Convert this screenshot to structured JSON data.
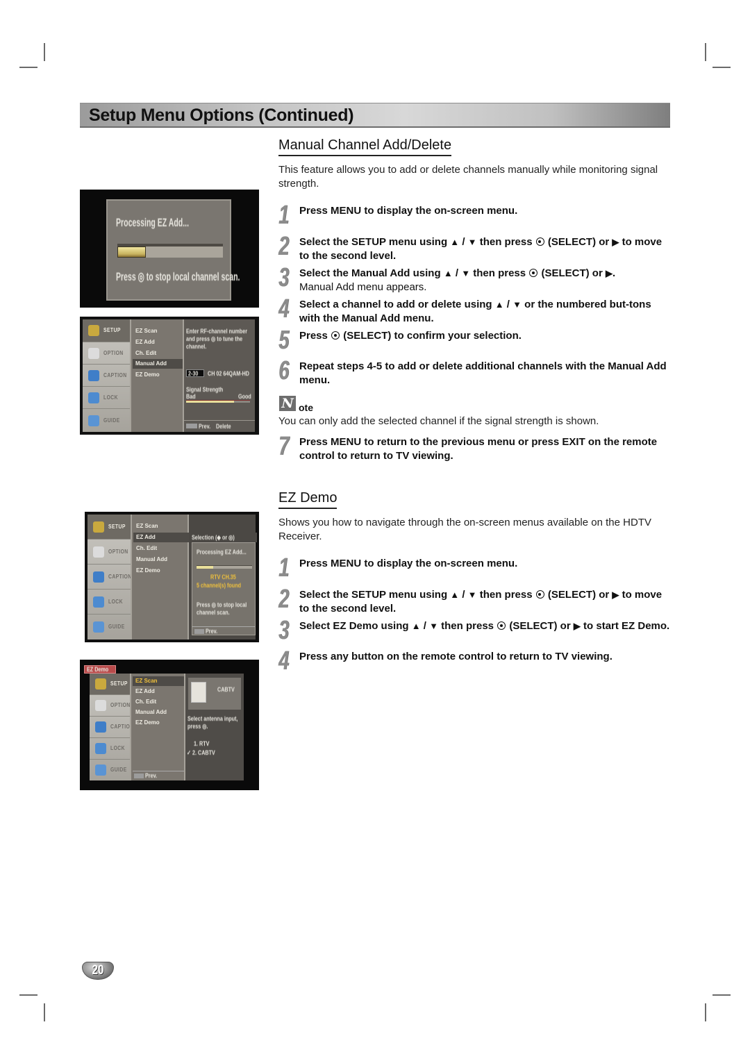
{
  "header": {
    "title": "Setup Menu Options (Continued)"
  },
  "manual_channel": {
    "title": "Manual Channel Add/Delete",
    "intro": "This feature allows you to add or delete channels manually while monitoring signal strength.",
    "steps": [
      {
        "num": "1",
        "parts": [
          "Press MENU to display the on-screen menu."
        ]
      },
      {
        "num": "2",
        "text_a": "Select the SETUP menu using ",
        "up": "▲",
        "slash": " / ",
        "down": "▼",
        "text_b": " then press ",
        "text_c": " (SELECT) or ",
        "right": "▶",
        "text_d": " to move to the second level."
      },
      {
        "num": "3",
        "text_a": "Select the Manual Add using ",
        "up": "▲",
        "slash": " / ",
        "down": "▼",
        "text_b": " then press ",
        "text_c": " (SELECT) or ",
        "right": "▶",
        "text_d": ".",
        "sub": "Manual Add menu appears."
      },
      {
        "num": "4",
        "text_a": "Select a channel to add or delete using ",
        "up": "▲",
        "slash": " / ",
        "down": "▼",
        "text_b": " or the numbered but-tons with the Manual Add menu."
      },
      {
        "num": "5",
        "text_a": "Press ",
        "text_b": " (SELECT) to confirm your selection."
      },
      {
        "num": "6",
        "text": "Repeat steps 4-5 to add or delete additional channels with the Manual Add menu."
      },
      {
        "num": "7",
        "text": "Press MENU to return to the previous menu or press EXIT on the remote control to return to TV viewing."
      }
    ],
    "note": {
      "icon_letter": "N",
      "label": "ote",
      "text": "You can only add the selected channel if the signal strength is shown."
    }
  },
  "ez_demo": {
    "title": "EZ Demo",
    "intro": "Shows you how to navigate through the on-screen menus available on the HDTV Receiver.",
    "steps": [
      {
        "num": "1",
        "text": "Press MENU to display the on-screen menu."
      },
      {
        "num": "2",
        "text_a": "Select the SETUP menu using ",
        "up": "▲",
        "slash": " / ",
        "down": "▼",
        "text_b": " then press ",
        "text_c": " (SELECT) or ",
        "right": "▶",
        "text_d": " to move to the second level."
      },
      {
        "num": "3",
        "text_a": "Select EZ Demo using ",
        "up": "▲",
        "slash": " / ",
        "down": "▼",
        "text_b": " then press ",
        "text_c": " (SELECT) or ",
        "right": "▶",
        "text_d": " to start EZ Demo."
      },
      {
        "num": "4",
        "text": "Press any button on the remote control to return to TV viewing."
      }
    ]
  },
  "screens": {
    "ez_add_progress": {
      "title": "Processing EZ Add...",
      "progress": 0.27,
      "hint": "Press ◎ to stop local channel scan."
    },
    "menu": {
      "sidebar": [
        "SETUP",
        "OPTION",
        "CAPTION",
        "LOCK",
        "GUIDE"
      ],
      "items": [
        "EZ Scan",
        "EZ Add",
        "Ch. Edit",
        "Manual Add",
        "EZ Demo"
      ]
    },
    "manual_add": {
      "selected_item": "Manual Add",
      "instruction": "Enter RF-channel number and press ◎ to tune the channel.",
      "channel": "2-30",
      "channel_info": "CH 02 64QAM-HD",
      "signal_label": "Signal Strength",
      "bad": "Bad",
      "good": "Good",
      "signal": 0.75,
      "footer_prev": "Prev.",
      "footer_delete": "Delete"
    },
    "ez_add": {
      "selected_item": "EZ Add",
      "selection_label": "Selection (◆ or ◎)",
      "title": "Processing EZ Add...",
      "progress": 0.3,
      "channel_line": "RTV CH.35",
      "found_line": "5 channel(s) found",
      "hint": "Press ◎ to stop local channel scan.",
      "footer_prev": "Prev."
    },
    "ez_scan": {
      "badge": "EZ Demo",
      "selected_item": "EZ Scan",
      "input_label": "CABTV",
      "instruction": "Select antenna input, press ◎.",
      "options": [
        "1. RTV",
        "2. CABTV"
      ],
      "checked_option": "2. CABTV",
      "footer_prev": "Prev."
    }
  },
  "page_number": "20",
  "colors": {
    "accent_grey": "#8c8c8c",
    "screen_panel": "#7a7670",
    "progress_yellow": "#e8dc8a"
  }
}
